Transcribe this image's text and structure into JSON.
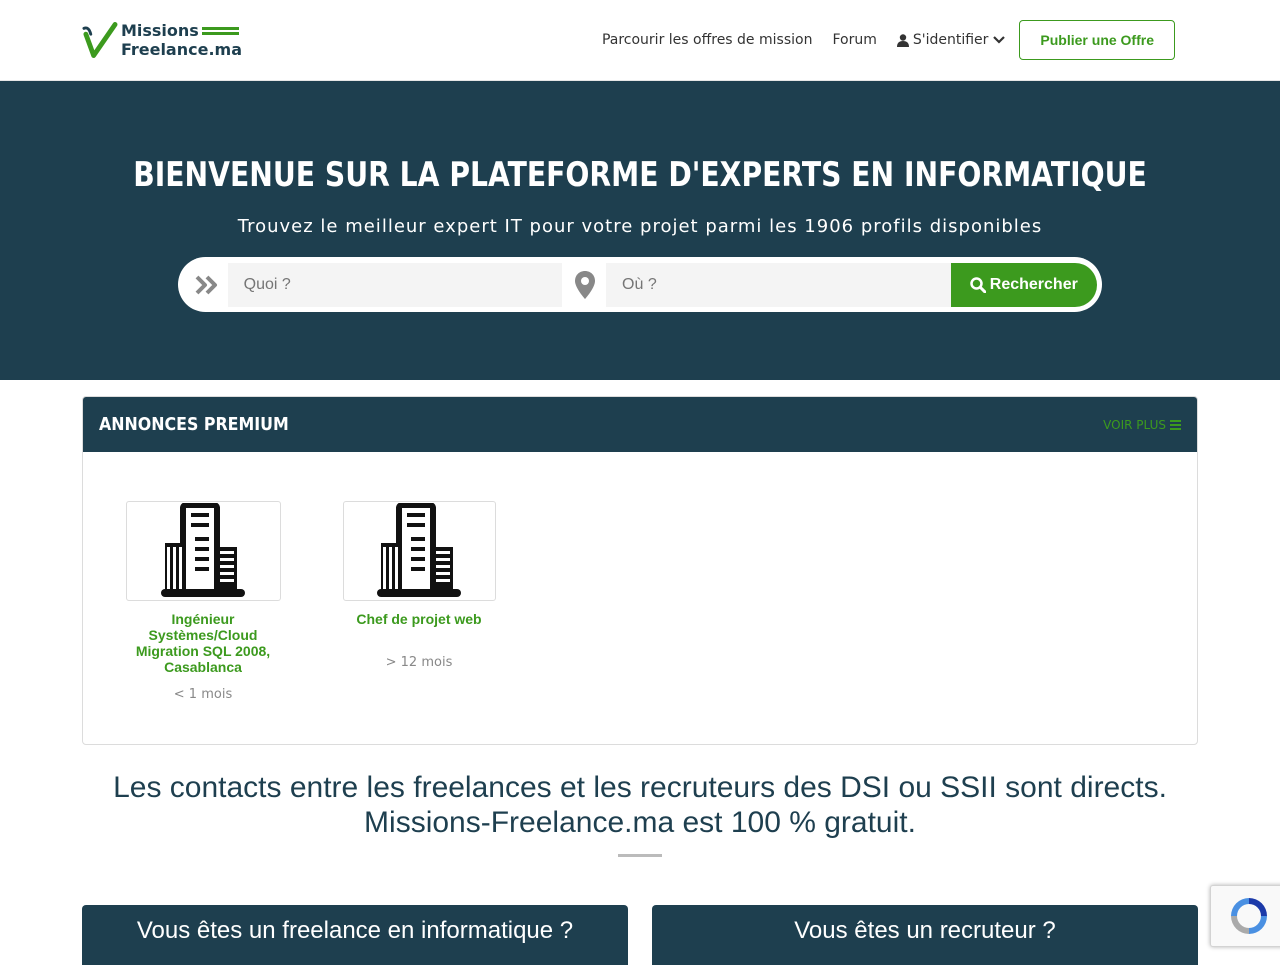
{
  "brand": {
    "line1": "Missions",
    "line2": "Freelance.ma"
  },
  "nav": {
    "browse": "Parcourir les offres de mission",
    "forum": "Forum",
    "login": "S'identifier",
    "publish": "Publier une Offre"
  },
  "hero": {
    "title": "BIENVENUE SUR LA PLATEFORME D'EXPERTS EN INFORMATIQUE",
    "subtitle": "Trouvez le meilleur expert IT pour votre projet parmi les 1906 profils disponibles"
  },
  "search": {
    "what_placeholder": "Quoi ?",
    "where_placeholder": "Où ?",
    "button": "Rechercher"
  },
  "premium": {
    "title": "ANNONCES PREMIUM",
    "more": "VOIR PLUS",
    "items": [
      {
        "title": "Ingénieur Systèmes/Cloud Migration SQL 2008, Casablanca",
        "age": "< 1 mois"
      },
      {
        "title": "Chef de projet web",
        "age": "> 12 mois"
      }
    ]
  },
  "tagline": {
    "line1": "Les contacts entre les freelances et les recruteurs des DSI ou SSII sont directs.",
    "line2": "Missions-Freelance.ma est 100 % gratuit."
  },
  "boxes": {
    "freelance": "Vous êtes un freelance en informatique ?",
    "recruiter": "Vous êtes un recruteur ?"
  },
  "colors": {
    "primary": "#1e3f4f",
    "accent": "#3c9a1e"
  }
}
